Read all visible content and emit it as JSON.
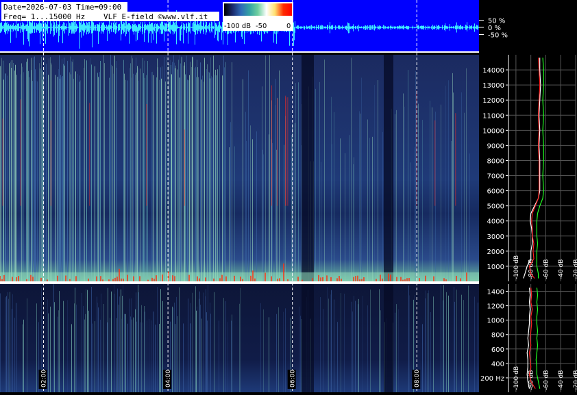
{
  "header": {
    "date_line": "Date=2026-07-03 Time=09:00",
    "freq_line": "Freq= 1...15000 Hz",
    "title_line": "VLF E-field ©www.vlf.it"
  },
  "colorbar": {
    "labels": [
      "-100 dB",
      "-50",
      "0"
    ],
    "stops": [
      "#000000",
      "#1a2a6c",
      "#2f6bb8",
      "#34a3a3",
      "#70d0a0",
      "#ffffff",
      "#ffe070",
      "#ff2a00",
      "#ff0000"
    ]
  },
  "colors": {
    "waveform_bg": "#0000ff",
    "waveform_trace": "#3ee9ff",
    "spectrogram_dark": "#0a1030",
    "spectrogram_mid": "#2a3d7a",
    "spectrogram_bright": "#7fd0b0",
    "spectrum_avg": "#ffffff",
    "spectrum_peak": "#ff2020",
    "spectrum_max": "#20ff20"
  },
  "chart_data": [
    {
      "type": "line",
      "panel": "waveform",
      "ylabel_ticks": [
        "50 %",
        "0 %",
        "-50 %"
      ],
      "y_values": [
        50,
        0,
        -50
      ]
    },
    {
      "type": "heatmap",
      "panel": "spectrogram-full",
      "ylim": [
        0,
        15000
      ],
      "y_ticks": [
        1000,
        2000,
        3000,
        4000,
        5000,
        6000,
        7000,
        8000,
        9000,
        10000,
        11000,
        12000,
        13000,
        14000
      ],
      "x_ticks": [
        "02:00",
        "04:00",
        "06:00",
        "08:00"
      ],
      "x_tick_positions_hours": [
        2,
        4,
        6,
        8
      ],
      "xlim_hours": [
        1.3,
        9.0
      ],
      "spectrum_ticks": [
        "-100 dB",
        "-80 dB",
        "-60 dB",
        "-40 dB",
        "-20 dB"
      ],
      "spectrum_tick_values": [
        -100,
        -80,
        -60,
        -40,
        -20
      ],
      "spectrum_xlim": [
        -110,
        -20
      ],
      "series": [
        {
          "name": "average",
          "freq": [
            200,
            500,
            1000,
            1500,
            2000,
            2500,
            3000,
            3500,
            4000,
            4500,
            5000,
            5500,
            6000,
            7000,
            8000,
            9000,
            10000,
            11000,
            12000,
            13000,
            14000,
            14800
          ],
          "db": [
            -90,
            -88,
            -85,
            -80,
            -80,
            -78,
            -78,
            -79,
            -81,
            -80,
            -75,
            -70,
            -68,
            -68,
            -68,
            -69,
            -68,
            -69,
            -68,
            -67,
            -68,
            -68
          ]
        },
        {
          "name": "peak",
          "freq": [
            200,
            500,
            1000,
            1500,
            2000,
            2500,
            3000,
            3500,
            4000,
            4500,
            5000,
            5500,
            6000,
            7000,
            8000,
            9000,
            10000,
            11000,
            12000,
            13000,
            14000,
            14800
          ],
          "db": [
            -75,
            -80,
            -82,
            -76,
            -77,
            -76,
            -78,
            -78,
            -79,
            -78,
            -74,
            -70,
            -69,
            -69,
            -69,
            -70,
            -69,
            -70,
            -69,
            -68,
            -69,
            -70
          ]
        },
        {
          "name": "max",
          "freq": [
            200,
            500,
            1000,
            1500,
            2000,
            2500,
            3000,
            3500,
            4000,
            4500,
            5000,
            5500,
            6000,
            7000,
            8000,
            9000,
            10000,
            11000,
            12000,
            13000,
            14000,
            14800
          ],
          "db": [
            -70,
            -70,
            -72,
            -72,
            -72,
            -71,
            -72,
            -72,
            -72,
            -71,
            -68,
            -64,
            -63,
            -64,
            -63,
            -63,
            -64,
            -63,
            -64,
            -63,
            -63,
            -64
          ]
        }
      ]
    },
    {
      "type": "heatmap",
      "panel": "spectrogram-low",
      "ylim": [
        0,
        1500
      ],
      "y_ticks": [
        200,
        400,
        600,
        800,
        1000,
        1200,
        1400
      ],
      "y_tick_labels": [
        "200 Hz",
        "400",
        "600",
        "800",
        "1000",
        "1200",
        "1400"
      ],
      "spectrum_ticks": [
        "-100 dB",
        "-80 dB",
        "-60 dB",
        "-40 dB",
        "-20 dB"
      ],
      "spectrum_tick_values": [
        -100,
        -80,
        -60,
        -40,
        -20
      ],
      "spectrum_xlim": [
        -110,
        -20
      ],
      "series": [
        {
          "name": "average",
          "freq": [
            50,
            150,
            250,
            350,
            450,
            550,
            650,
            750,
            850,
            950,
            1050,
            1150,
            1250,
            1350,
            1450
          ],
          "db": [
            -82,
            -84,
            -85,
            -84,
            -84,
            -85,
            -83,
            -84,
            -83,
            -82,
            -82,
            -81,
            -82,
            -81,
            -82
          ]
        },
        {
          "name": "peak",
          "freq": [
            50,
            150,
            250,
            350,
            450,
            550,
            650,
            750,
            850,
            950,
            1050,
            1150,
            1250,
            1350,
            1450
          ],
          "db": [
            -74,
            -80,
            -82,
            -80,
            -81,
            -82,
            -80,
            -81,
            -80,
            -79,
            -80,
            -78,
            -80,
            -79,
            -80
          ]
        },
        {
          "name": "max",
          "freq": [
            50,
            150,
            250,
            350,
            450,
            550,
            650,
            750,
            850,
            950,
            1050,
            1150,
            1250,
            1350,
            1450
          ],
          "db": [
            -68,
            -70,
            -72,
            -72,
            -73,
            -72,
            -71,
            -72,
            -71,
            -72,
            -72,
            -71,
            -72,
            -71,
            -72
          ]
        }
      ]
    }
  ]
}
